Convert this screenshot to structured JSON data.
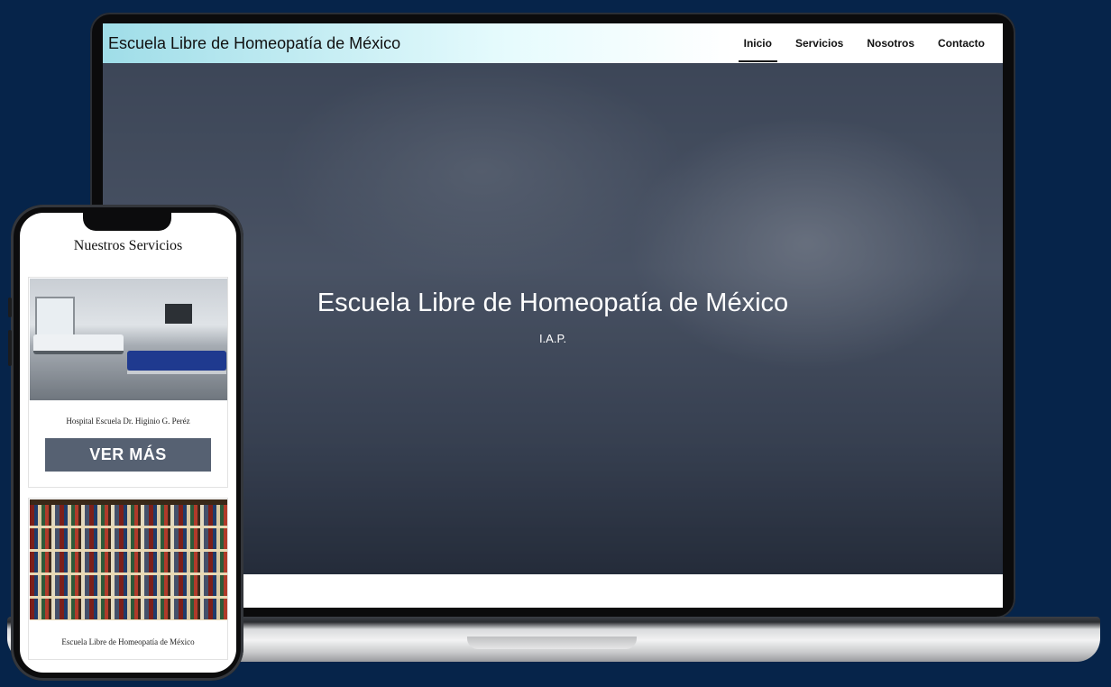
{
  "desktop": {
    "brand": "Escuela Libre de Homeopatía de México",
    "nav": [
      {
        "label": "Inicio",
        "active": true
      },
      {
        "label": "Servicios",
        "active": false
      },
      {
        "label": "Nosotros",
        "active": false
      },
      {
        "label": "Contacto",
        "active": false
      }
    ],
    "hero": {
      "title": "Escuela Libre de Homeopatía de México",
      "subtitle": "I.A.P."
    }
  },
  "mobile": {
    "section_title": "Nuestros Servicios",
    "cards": [
      {
        "caption": "Hospital Escuela Dr. Higinio G. Peréz",
        "button": "VER MÁS"
      },
      {
        "caption": "Escuela Libre de Homeopatía de México"
      }
    ]
  },
  "colors": {
    "page_background": "#06244a",
    "button": "#566172",
    "navbar_gradient_start": "#9fdde8"
  }
}
